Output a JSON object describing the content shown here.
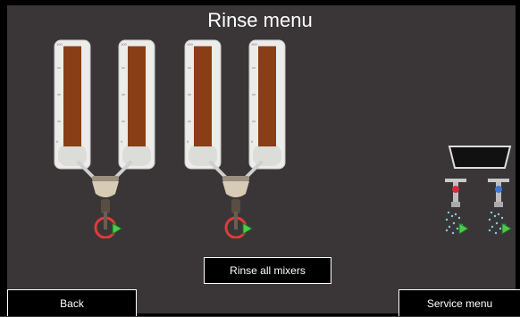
{
  "header": {
    "title": "Rinse menu"
  },
  "canisters": [
    {
      "id": "canister-1",
      "scale_top": "100",
      "scale_bottom": "0",
      "fill_percent": 92
    },
    {
      "id": "canister-2",
      "scale_top": "100",
      "scale_bottom": "0",
      "fill_percent": 92
    },
    {
      "id": "canister-3",
      "scale_top": "100",
      "scale_bottom": "0",
      "fill_percent": 92
    },
    {
      "id": "canister-4",
      "scale_top": "100",
      "scale_bottom": "0",
      "fill_percent": 92
    }
  ],
  "mixers": [
    {
      "id": "mixer-1",
      "icon": "mixer-bowl-icon",
      "rinse_icon": "play-icon"
    },
    {
      "id": "mixer-2",
      "icon": "mixer-bowl-icon",
      "rinse_icon": "play-icon"
    }
  ],
  "water": {
    "bowl_icon": "drip-tray-icon",
    "taps": [
      {
        "id": "hot-water-tap",
        "icon": "tap-icon",
        "knob_color": "#d8283a"
      },
      {
        "id": "cold-water-tap",
        "icon": "tap-icon",
        "knob_color": "#3a78d8"
      }
    ]
  },
  "buttons": {
    "rinse_all_label": "Rinse all mixers",
    "back_label": "Back",
    "service_label": "Service menu"
  },
  "colors": {
    "background": "#3a3637",
    "ingredient": "#8a3e15",
    "play_green": "#4ec94e",
    "ring_red": "#e23a3a"
  }
}
